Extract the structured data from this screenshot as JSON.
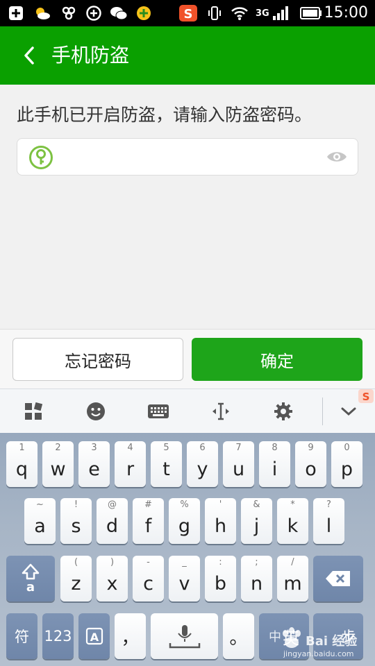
{
  "status_bar": {
    "time": "15:00",
    "network": "3G",
    "icons": [
      "notification-plus-icon",
      "weather-icon",
      "app-icon",
      "add-circle-icon",
      "wechat-icon",
      "security-app-icon",
      "sogou-input-icon",
      "vibrate-icon",
      "wifi-icon",
      "signal-icon",
      "battery-icon"
    ]
  },
  "app_bar": {
    "title": "手机防盗",
    "back_icon": "chevron-left-icon"
  },
  "prompt": {
    "text": "此手机已开启防盗，请输入防盗密码。"
  },
  "password_field": {
    "value": "",
    "placeholder": "",
    "left_icon": "key-icon",
    "right_icon": "eye-icon"
  },
  "buttons": {
    "forgot": "忘记密码",
    "confirm": "确定"
  },
  "keyboard_toolbar": {
    "items": [
      "grid-menu-icon",
      "emoji-icon",
      "keyboard-icon",
      "cursor-move-icon",
      "gear-icon",
      "chevron-down-icon"
    ]
  },
  "keyboard": {
    "row1": [
      {
        "main": "q",
        "sub": "1"
      },
      {
        "main": "w",
        "sub": "2"
      },
      {
        "main": "e",
        "sub": "3"
      },
      {
        "main": "r",
        "sub": "4"
      },
      {
        "main": "t",
        "sub": "5"
      },
      {
        "main": "y",
        "sub": "6"
      },
      {
        "main": "u",
        "sub": "7"
      },
      {
        "main": "i",
        "sub": "8"
      },
      {
        "main": "o",
        "sub": "9"
      },
      {
        "main": "p",
        "sub": "0"
      }
    ],
    "row2": [
      {
        "main": "a",
        "sub": "~"
      },
      {
        "main": "s",
        "sub": "!"
      },
      {
        "main": "d",
        "sub": "@"
      },
      {
        "main": "f",
        "sub": "#"
      },
      {
        "main": "g",
        "sub": "%"
      },
      {
        "main": "h",
        "sub": "'"
      },
      {
        "main": "j",
        "sub": "&"
      },
      {
        "main": "k",
        "sub": "*"
      },
      {
        "main": "l",
        "sub": "?"
      }
    ],
    "row3": [
      {
        "main": "z",
        "sub": "("
      },
      {
        "main": "x",
        "sub": ")"
      },
      {
        "main": "c",
        "sub": "-"
      },
      {
        "main": "v",
        "sub": "_"
      },
      {
        "main": "b",
        "sub": ":"
      },
      {
        "main": "n",
        "sub": ";"
      },
      {
        "main": "m",
        "sub": "/"
      }
    ],
    "shift_sub": "a",
    "symbol": "符",
    "num": "123",
    "comma": "，",
    "period": "。",
    "lang_zh": "中",
    "lang_en": "英",
    "enter_partial": "步"
  },
  "watermark": {
    "brand": "Bai 经验",
    "url": "jingyan.baidu.com"
  },
  "colors": {
    "app_bar": "#0aa000",
    "confirm": "#1ea51a",
    "key_green": "#7dc242"
  }
}
